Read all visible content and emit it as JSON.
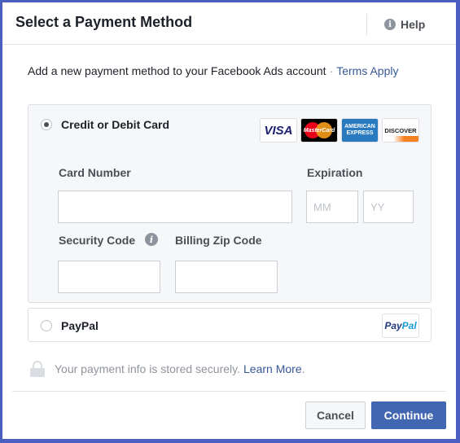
{
  "dialog": {
    "title": "Select a Payment Method",
    "help_label": "Help"
  },
  "intro": {
    "text": "Add a new payment method to your Facebook Ads account",
    "separator": "·",
    "terms_link": "Terms Apply"
  },
  "card_option": {
    "label": "Credit or Debit Card",
    "selected": true,
    "logos": {
      "visa": "VISA",
      "mastercard": "MasterCard",
      "amex_line1": "AMERICAN",
      "amex_line2": "EXPRESS",
      "discover": "DISCOVER"
    },
    "card_number_label": "Card Number",
    "card_number_value": "",
    "expiration_label": "Expiration",
    "month_placeholder": "MM",
    "year_placeholder": "YY",
    "security_code_label": "Security Code",
    "security_code_value": "",
    "zip_label": "Billing Zip Code",
    "zip_value": ""
  },
  "paypal_option": {
    "label": "PayPal",
    "selected": false,
    "logo_pay": "Pay",
    "logo_pal": "Pal"
  },
  "secure": {
    "text": "Your payment info is stored securely.",
    "link": "Learn More",
    "trailing": "."
  },
  "footer": {
    "cancel_label": "Cancel",
    "continue_label": "Continue"
  },
  "colors": {
    "frame": "#4a5fc1",
    "primary_button": "#4267b2",
    "link": "#365899"
  },
  "icons": {
    "help": "info-circle-icon",
    "security_info": "info-circle-icon",
    "lock": "lock-icon"
  }
}
